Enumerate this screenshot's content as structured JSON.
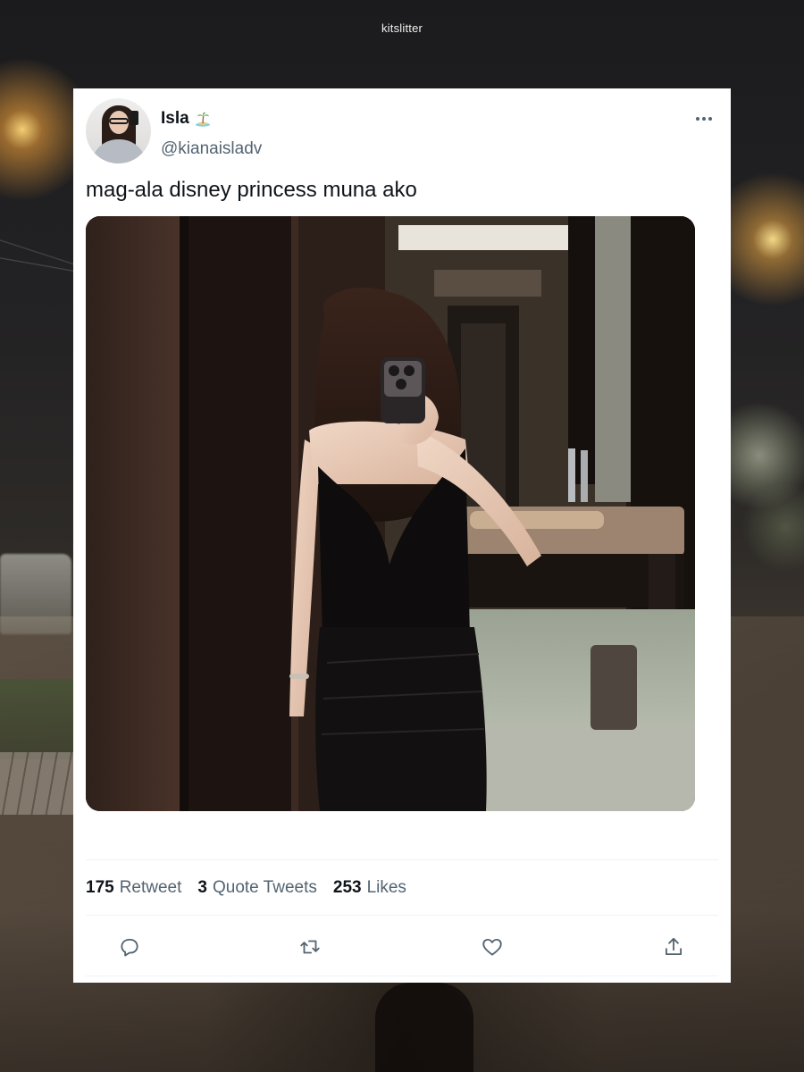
{
  "watermark": "kitslitter",
  "tweet": {
    "display_name": "Isla",
    "name_emoji_icon": "desert-island-icon",
    "handle": "@kianaisladv",
    "text": "mag-ala disney princess muna ako",
    "media_icon": "mirror-selfie-photo"
  },
  "stats": [
    {
      "count": "175",
      "label": "Retweet"
    },
    {
      "count": "3",
      "label": "Quote Tweets"
    },
    {
      "count": "253",
      "label": "Likes"
    }
  ],
  "actions": [
    {
      "icon": "reply-icon"
    },
    {
      "icon": "retweet-icon"
    },
    {
      "icon": "like-icon"
    },
    {
      "icon": "share-icon"
    }
  ],
  "colors": {
    "text_primary": "#0f1419",
    "text_secondary": "#536471",
    "divider": "#eff3f4",
    "card_background": "#ffffff"
  }
}
